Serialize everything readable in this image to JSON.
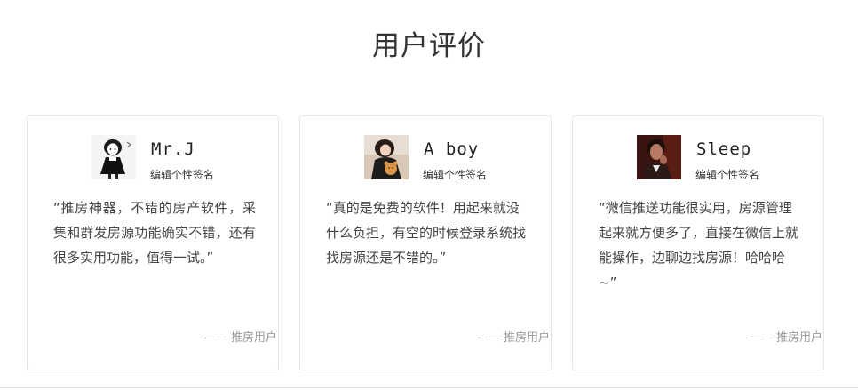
{
  "section": {
    "title": "用户评价"
  },
  "reviews": [
    {
      "name": "Mr.J",
      "signature": "编辑个性签名",
      "quote": "“推房神器，不错的房产软件，采集和群发房源功能确实不错，还有很多实用功能，值得一试。”",
      "from": "—— 推房用户",
      "avatar_icon": "avatar-cartoon-girl-icon"
    },
    {
      "name": "A boy",
      "signature": "编辑个性签名",
      "quote": "“真的是免费的软件！用起来就没什么负担，有空的时候登录系统找找房源还是不错的。”",
      "from": "—— 推房用户",
      "avatar_icon": "avatar-girl-with-teddy-icon"
    },
    {
      "name": "Sleep",
      "signature": "编辑个性签名",
      "quote": "“微信推送功能很实用，房源管理起来就方便多了，直接在微信上就能操作，边聊边找房源！哈哈哈~”",
      "from": "—— 推房用户",
      "avatar_icon": "avatar-man-portrait-icon"
    }
  ]
}
